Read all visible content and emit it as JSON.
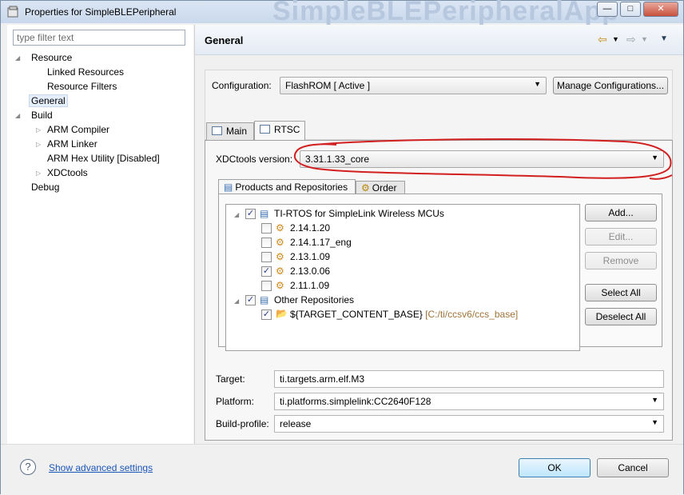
{
  "window": {
    "title": "Properties for SimpleBLEPeripheral",
    "background_title": "SimpleBLEPeripheralApp",
    "controls": {
      "minimize": "—",
      "maximize": "□",
      "close": "✕"
    }
  },
  "filter": {
    "placeholder": "type filter text"
  },
  "tree": [
    {
      "label": "Resource"
    },
    {
      "label": "Linked Resources"
    },
    {
      "label": "Resource Filters"
    },
    {
      "label": "General"
    },
    {
      "label": "Build"
    },
    {
      "label": "ARM Compiler"
    },
    {
      "label": "ARM Linker"
    },
    {
      "label": "ARM Hex Utility  [Disabled]"
    },
    {
      "label": "XDCtools"
    },
    {
      "label": "Debug"
    }
  ],
  "page": {
    "title": "General"
  },
  "configuration": {
    "label": "Configuration:",
    "value": "FlashROM  [ Active ]",
    "manage_button": "Manage Configurations..."
  },
  "tabs": [
    {
      "label": "Main"
    },
    {
      "label": "RTSC"
    }
  ],
  "xdc": {
    "label": "XDCtools version:",
    "value": "3.31.1.33_core"
  },
  "subtabs": [
    {
      "label": "Products and Repositories"
    },
    {
      "label": "Order"
    }
  ],
  "repositories": [
    {
      "label": "TI-RTOS for SimpleLink Wireless MCUs",
      "checked": true
    },
    {
      "label": "2.14.1.20",
      "checked": false
    },
    {
      "label": "2.14.1.17_eng",
      "checked": false
    },
    {
      "label": "2.13.1.09",
      "checked": false
    },
    {
      "label": "2.13.0.06",
      "checked": true
    },
    {
      "label": "2.11.1.09",
      "checked": false
    },
    {
      "label": "Other Repositories",
      "checked": true
    },
    {
      "label": "${TARGET_CONTENT_BASE}",
      "path": "[C:/ti/ccsv6/ccs_base]",
      "checked": true
    }
  ],
  "repo_buttons": {
    "add": "Add...",
    "edit": "Edit...",
    "remove": "Remove",
    "select_all": "Select All",
    "deselect_all": "Deselect All"
  },
  "target": {
    "label": "Target:",
    "value": "ti.targets.arm.elf.M3"
  },
  "platform": {
    "label": "Platform:",
    "value": "ti.platforms.simplelink:CC2640F128"
  },
  "build_profile": {
    "label": "Build-profile:",
    "value": "release"
  },
  "footer": {
    "help": "?",
    "advanced_link": "Show advanced settings",
    "ok": "OK",
    "cancel": "Cancel"
  },
  "colors": {
    "annotation": "#d21f1f",
    "link": "#1a55b8",
    "path": "#a0743a"
  },
  "icons": {
    "title": "properties-icon",
    "tab": "table-icon",
    "product": "package-icon",
    "repository": "folder-icon",
    "order": "order-icon"
  }
}
